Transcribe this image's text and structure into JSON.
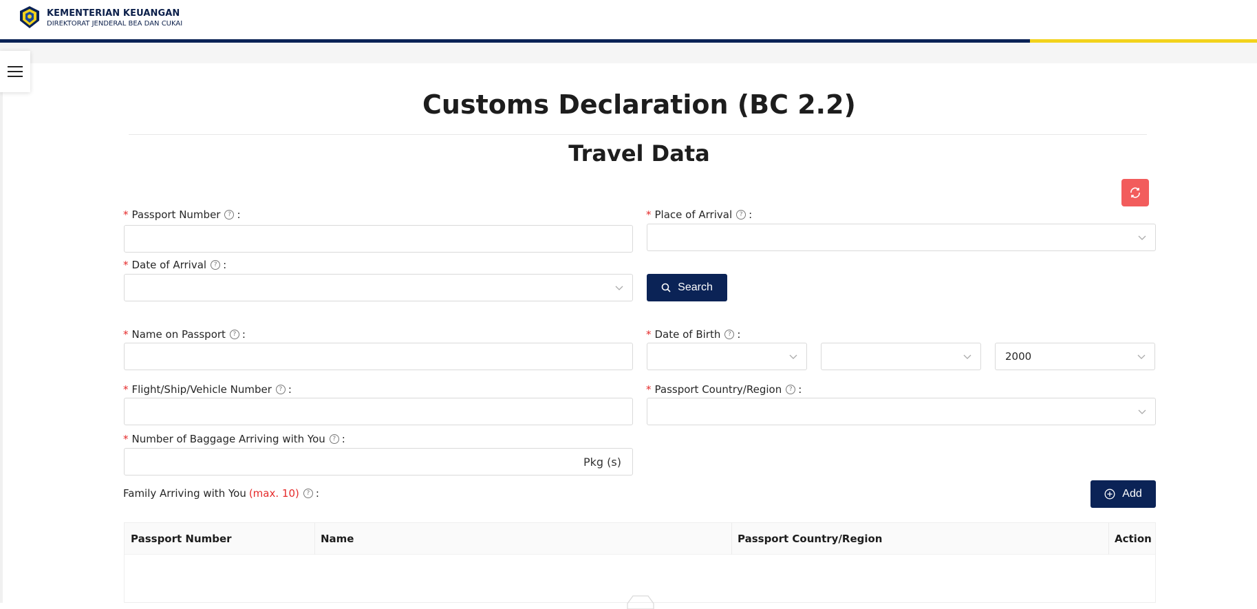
{
  "header": {
    "org_name": "KEMENTERIAN KEUANGAN",
    "org_sub": "DIREKTORAT JENDERAL BEA DAN CUKAI"
  },
  "page": {
    "title": "Customs Declaration (BC 2.2)",
    "section": "Travel Data"
  },
  "form": {
    "passport_number": {
      "label": "Passport Number",
      "value": ""
    },
    "place_of_arrival": {
      "label": "Place of Arrival",
      "value": ""
    },
    "date_of_arrival": {
      "label": "Date of Arrival",
      "value": ""
    },
    "search_label": "Search",
    "name_on_passport": {
      "label": "Name on Passport",
      "value": ""
    },
    "date_of_birth": {
      "label": "Date of Birth",
      "day": "",
      "month": "",
      "year": "2000"
    },
    "flight_number": {
      "label": "Flight/Ship/Vehicle Number",
      "value": ""
    },
    "passport_country": {
      "label": "Passport Country/Region",
      "value": ""
    },
    "baggage": {
      "label": "Number of Baggage Arriving with You",
      "value": "",
      "suffix": "Pkg (s)"
    },
    "family": {
      "label": "Family Arriving with You",
      "max": "(max. 10)"
    },
    "add_label": "Add",
    "colon": ":"
  },
  "table": {
    "columns": [
      "Passport Number",
      "Name",
      "Passport Country/Region",
      "Action"
    ]
  },
  "colors": {
    "navy": "#0b2356",
    "accent_yellow": "#f2d21c",
    "danger": "#f25c5c",
    "required": "#e52b2b"
  },
  "icons": {
    "menu": "hamburger-icon",
    "refresh": "refresh-icon",
    "search": "search-icon",
    "add": "plus-circle-icon",
    "help": "question-circle-icon",
    "dropdown": "chevron-down-icon"
  }
}
